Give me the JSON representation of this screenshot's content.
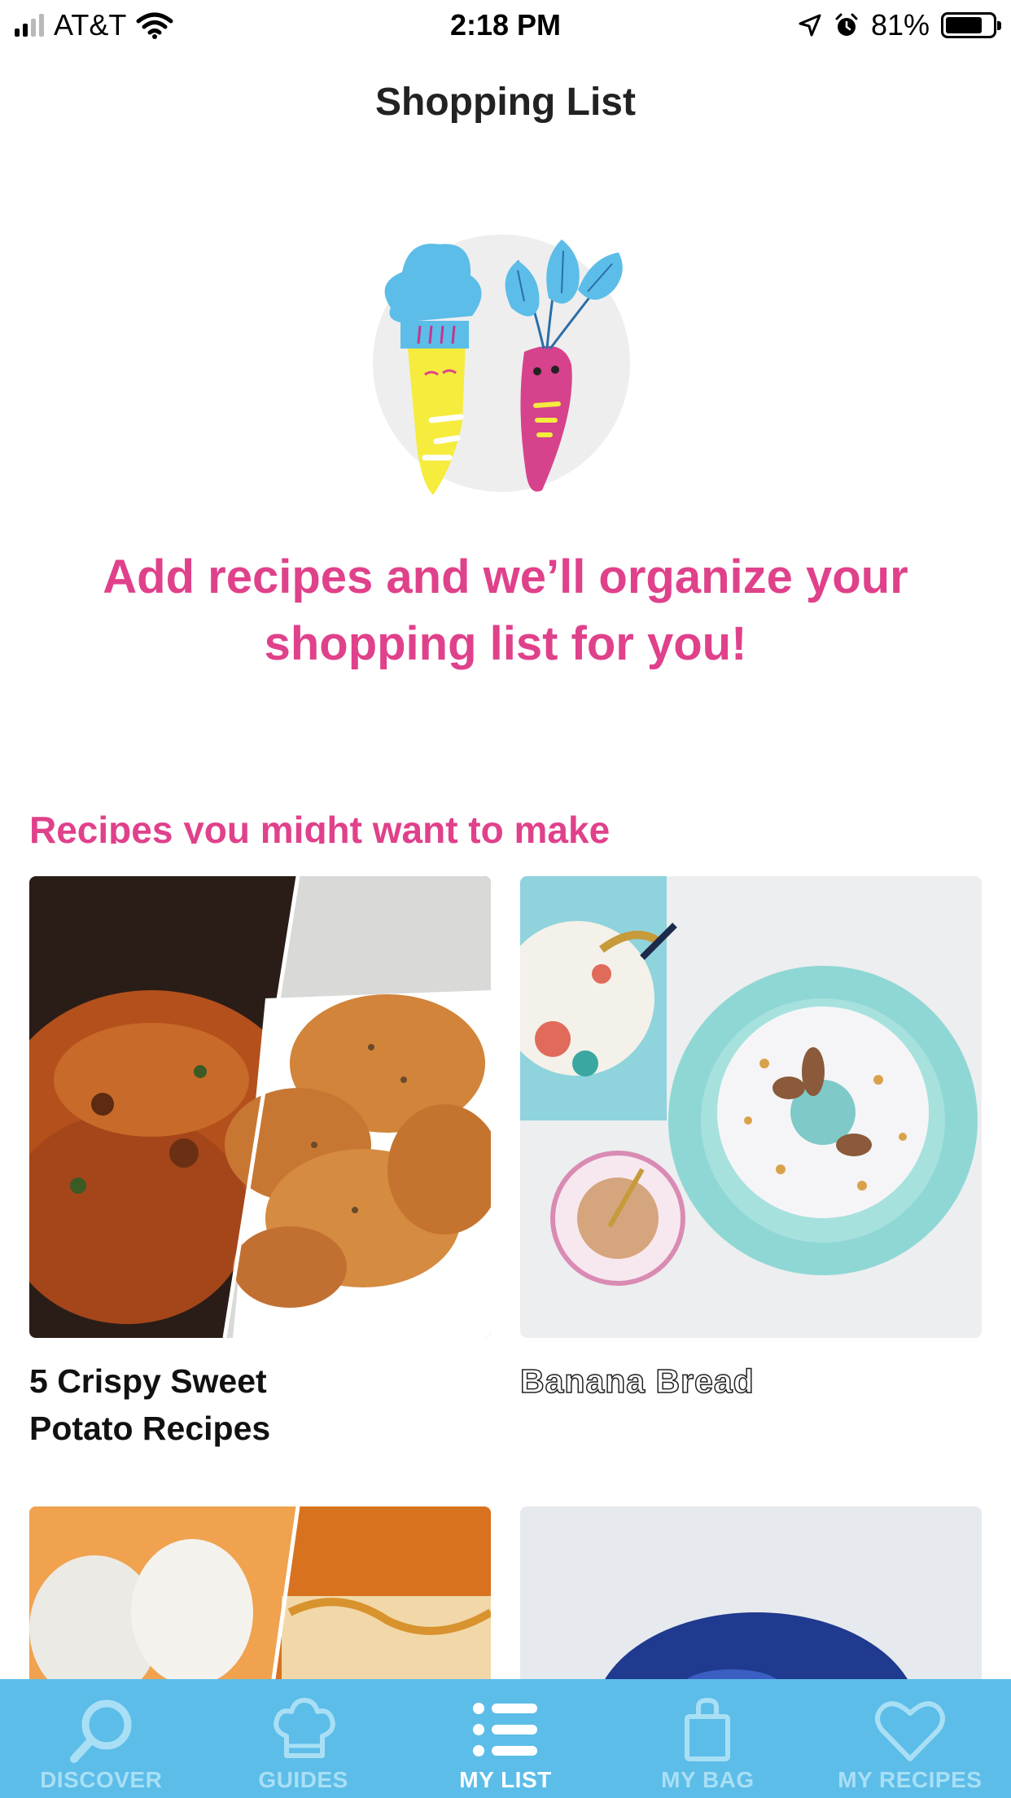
{
  "status_bar": {
    "carrier": "AT&T",
    "time": "2:18 PM",
    "battery_percent": "81%",
    "battery_level": 0.81,
    "icons": [
      "signal-icon",
      "wifi-icon",
      "location-arrow-icon",
      "alarm-icon",
      "battery-icon"
    ]
  },
  "header": {
    "title": "Shopping List"
  },
  "empty_state": {
    "illustration": "chef-vegetables-illustration",
    "message": "Add recipes and we’ll organize your shopping list for you!"
  },
  "recommendations": {
    "heading": "Recipes you might want to make",
    "items": [
      {
        "title": "5 Crispy Sweet Potato Recipes",
        "image": "sweet-potato-photo"
      },
      {
        "title": "Banana Bread",
        "image": "bundt-cake-photo"
      },
      {
        "title": "",
        "image": "pumpkin-bars-photo"
      },
      {
        "title": "",
        "image": "galaxy-dessert-photo"
      }
    ]
  },
  "tab_bar": {
    "active": "MY LIST",
    "colors": {
      "background": "#5cbde8",
      "inactive": "#a9dff5",
      "active": "#ffffff"
    },
    "tabs": [
      {
        "label": "DISCOVER",
        "icon": "search-icon"
      },
      {
        "label": "GUIDES",
        "icon": "chef-hat-icon"
      },
      {
        "label": "MY LIST",
        "icon": "list-icon"
      },
      {
        "label": "MY BAG",
        "icon": "shopping-bag-icon"
      },
      {
        "label": "MY RECIPES",
        "icon": "heart-icon"
      }
    ]
  },
  "accent_colors": {
    "pink": "#e0418b",
    "blue": "#5cbde8"
  }
}
